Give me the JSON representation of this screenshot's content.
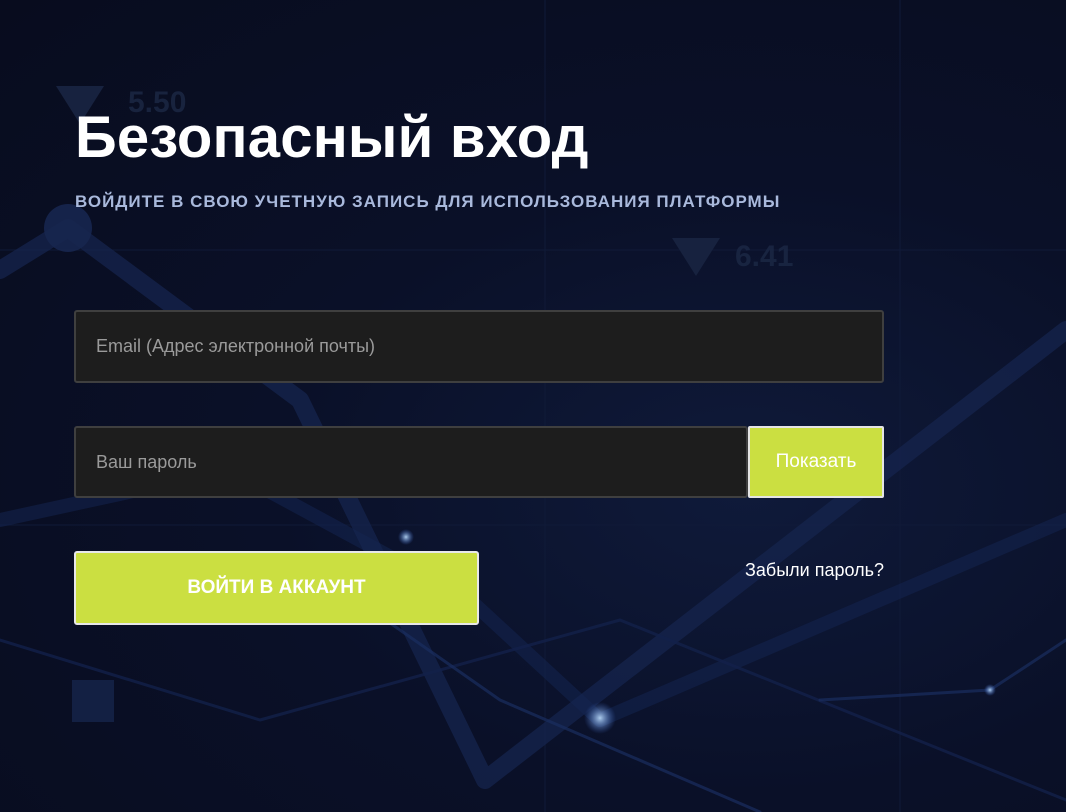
{
  "login": {
    "title": "Безопасный вход",
    "subtitle": "ВОЙДИТЕ В СВОЮ УЧЕТНУЮ ЗАПИСЬ ДЛЯ ИСПОЛЬЗОВАНИЯ ПЛАТФОРМЫ",
    "email_placeholder": "Email (Адрес электронной почты)",
    "email_value": "",
    "password_placeholder": "Ваш пароль",
    "password_value": "",
    "show_label": "Показать",
    "submit_label": "ВОЙТИ В АККАУНТ",
    "forgot_label": "Забыли пароль?"
  },
  "background": {
    "ticker_1": "5.50",
    "ticker_2": "6.41"
  },
  "colors": {
    "accent": "#cbdf41",
    "background": "#0a0f24",
    "field_bg": "#1d1d1d",
    "subtitle": "#a9b9dc"
  }
}
